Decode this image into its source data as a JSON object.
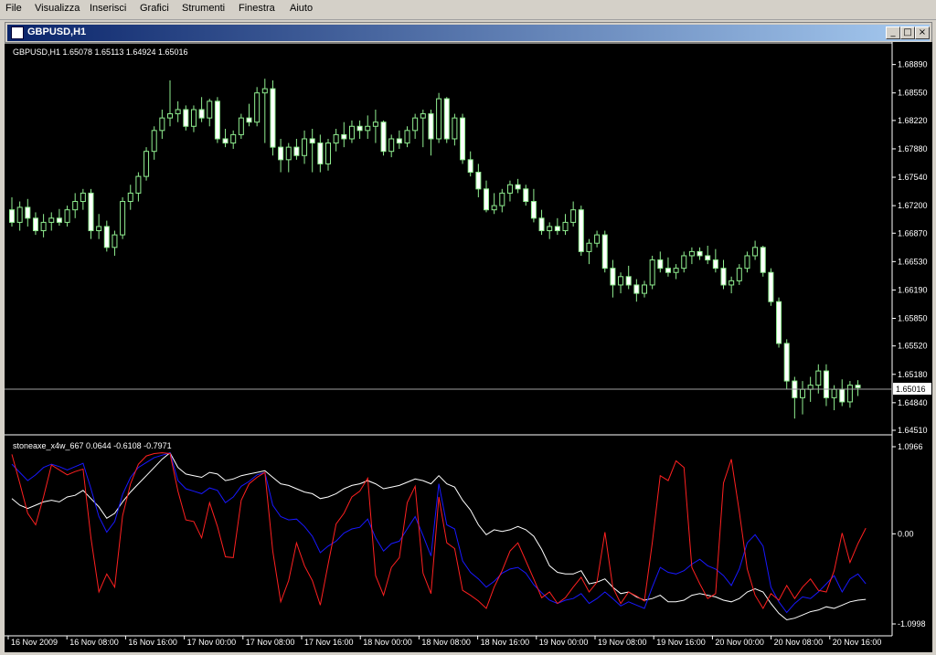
{
  "menu": [
    "File",
    "Visualizza",
    "Inserisci",
    "Grafici",
    "Strumenti",
    "Finestra",
    "Aiuto"
  ],
  "window": {
    "title": "GBPUSD,H1"
  },
  "price_panel": {
    "info": "GBPUSD,H1  1.65078 1.65113 1.64924 1.65016",
    "price_labels": [
      "1.68890",
      "1.68550",
      "1.68220",
      "1.67880",
      "1.67540",
      "1.67200",
      "1.66870",
      "1.66530",
      "1.66190",
      "1.65850",
      "1.65520",
      "1.65180",
      "1.64840",
      "1.64510"
    ],
    "current_price": "1.65016",
    "colors": {
      "candle": "#90ee90",
      "bull_body": "#000000",
      "bear_body": "#ffffff",
      "grid": "#ffffff"
    }
  },
  "indicator_panel": {
    "info": "stoneaxe_x4w_667 0.0644 -0.6108 -0.7971",
    "scale_labels": [
      "1.0966",
      "0.00",
      "-1.0998"
    ]
  },
  "time_labels": [
    "16 Nov 2009",
    "16 Nov 08:00",
    "16 Nov 16:00",
    "17 Nov 00:00",
    "17 Nov 08:00",
    "17 Nov 16:00",
    "18 Nov 00:00",
    "18 Nov 08:00",
    "18 Nov 16:00",
    "19 Nov 00:00",
    "19 Nov 08:00",
    "19 Nov 16:00",
    "20 Nov 00:00",
    "20 Nov 08:00",
    "20 Nov 16:00"
  ],
  "chart_data": {
    "type": "candlestick",
    "symbol": "GBPUSD",
    "timeframe": "H1",
    "ylim": [
      1.6451,
      1.6905
    ],
    "ohlc": [
      [
        1.6715,
        1.673,
        1.6695,
        1.67
      ],
      [
        1.67,
        1.6725,
        1.669,
        1.6718
      ],
      [
        1.6718,
        1.6728,
        1.6695,
        1.6705
      ],
      [
        1.6705,
        1.6712,
        1.6685,
        1.669
      ],
      [
        1.669,
        1.671,
        1.6682,
        1.67
      ],
      [
        1.67,
        1.6712,
        1.669,
        1.6705
      ],
      [
        1.6705,
        1.6716,
        1.6696,
        1.67
      ],
      [
        1.67,
        1.672,
        1.6695,
        1.6715
      ],
      [
        1.6715,
        1.6735,
        1.6705,
        1.6725
      ],
      [
        1.6725,
        1.674,
        1.6715,
        1.6735
      ],
      [
        1.6735,
        1.674,
        1.668,
        1.669
      ],
      [
        1.669,
        1.671,
        1.668,
        1.6695
      ],
      [
        1.6695,
        1.6702,
        1.6665,
        1.667
      ],
      [
        1.667,
        1.669,
        1.666,
        1.6685
      ],
      [
        1.6685,
        1.673,
        1.668,
        1.6725
      ],
      [
        1.6725,
        1.6745,
        1.6715,
        1.6735
      ],
      [
        1.6735,
        1.676,
        1.6725,
        1.6755
      ],
      [
        1.6755,
        1.679,
        1.675,
        1.6785
      ],
      [
        1.6785,
        1.6815,
        1.6775,
        1.681
      ],
      [
        1.681,
        1.6835,
        1.68,
        1.6825
      ],
      [
        1.6825,
        1.687,
        1.6815,
        1.683
      ],
      [
        1.683,
        1.6845,
        1.682,
        1.6835
      ],
      [
        1.6835,
        1.684,
        1.681,
        1.6815
      ],
      [
        1.6815,
        1.684,
        1.6808,
        1.6835
      ],
      [
        1.6835,
        1.685,
        1.682,
        1.6825
      ],
      [
        1.6825,
        1.6848,
        1.6815,
        1.6845
      ],
      [
        1.6845,
        1.685,
        1.6795,
        1.68
      ],
      [
        1.68,
        1.6812,
        1.679,
        1.6795
      ],
      [
        1.6795,
        1.681,
        1.6788,
        1.6805
      ],
      [
        1.6805,
        1.683,
        1.68,
        1.6825
      ],
      [
        1.6825,
        1.6842,
        1.6815,
        1.682
      ],
      [
        1.682,
        1.6862,
        1.6815,
        1.6855
      ],
      [
        1.6855,
        1.6872,
        1.6795,
        1.686
      ],
      [
        1.686,
        1.687,
        1.678,
        1.679
      ],
      [
        1.679,
        1.68,
        1.676,
        1.6775
      ],
      [
        1.6775,
        1.6795,
        1.676,
        1.679
      ],
      [
        1.679,
        1.68,
        1.6775,
        1.678
      ],
      [
        1.678,
        1.681,
        1.677,
        1.68
      ],
      [
        1.68,
        1.6812,
        1.676,
        1.6795
      ],
      [
        1.6795,
        1.6805,
        1.676,
        1.677
      ],
      [
        1.677,
        1.68,
        1.6762,
        1.6795
      ],
      [
        1.6795,
        1.6812,
        1.6785,
        1.6805
      ],
      [
        1.6805,
        1.682,
        1.679,
        1.68
      ],
      [
        1.68,
        1.6822,
        1.6795,
        1.6815
      ],
      [
        1.6815,
        1.6822,
        1.68,
        1.681
      ],
      [
        1.681,
        1.6828,
        1.68,
        1.6815
      ],
      [
        1.6815,
        1.6835,
        1.6795,
        1.682
      ],
      [
        1.682,
        1.6822,
        1.678,
        1.6785
      ],
      [
        1.6785,
        1.6805,
        1.6778,
        1.68
      ],
      [
        1.68,
        1.681,
        1.6788,
        1.6795
      ],
      [
        1.6795,
        1.6815,
        1.679,
        1.681
      ],
      [
        1.681,
        1.683,
        1.68,
        1.6825
      ],
      [
        1.6825,
        1.6835,
        1.679,
        1.683
      ],
      [
        1.683,
        1.6835,
        1.678,
        1.68
      ],
      [
        1.68,
        1.6855,
        1.6795,
        1.6848
      ],
      [
        1.6848,
        1.685,
        1.6795,
        1.68
      ],
      [
        1.68,
        1.683,
        1.6792,
        1.6825
      ],
      [
        1.6825,
        1.683,
        1.677,
        1.6775
      ],
      [
        1.6775,
        1.6785,
        1.6755,
        1.676
      ],
      [
        1.676,
        1.677,
        1.673,
        1.674
      ],
      [
        1.674,
        1.675,
        1.6712,
        1.6715
      ],
      [
        1.6715,
        1.6735,
        1.671,
        1.672
      ],
      [
        1.672,
        1.674,
        1.6712,
        1.6735
      ],
      [
        1.6735,
        1.675,
        1.6725,
        1.6745
      ],
      [
        1.6745,
        1.6752,
        1.6735,
        1.674
      ],
      [
        1.674,
        1.6745,
        1.672,
        1.6725
      ],
      [
        1.6725,
        1.674,
        1.67,
        1.6705
      ],
      [
        1.6705,
        1.6715,
        1.6685,
        1.669
      ],
      [
        1.669,
        1.67,
        1.668,
        1.6695
      ],
      [
        1.6695,
        1.6705,
        1.6685,
        1.669
      ],
      [
        1.669,
        1.671,
        1.6685,
        1.67
      ],
      [
        1.67,
        1.6725,
        1.6695,
        1.6715
      ],
      [
        1.6715,
        1.672,
        1.666,
        1.6665
      ],
      [
        1.6665,
        1.668,
        1.665,
        1.6675
      ],
      [
        1.6675,
        1.669,
        1.667,
        1.6685
      ],
      [
        1.6685,
        1.669,
        1.664,
        1.6645
      ],
      [
        1.6645,
        1.6655,
        1.661,
        1.6625
      ],
      [
        1.6625,
        1.664,
        1.6615,
        1.6635
      ],
      [
        1.6635,
        1.6648,
        1.662,
        1.6625
      ],
      [
        1.6625,
        1.6632,
        1.6605,
        1.6615
      ],
      [
        1.6615,
        1.663,
        1.661,
        1.6625
      ],
      [
        1.6625,
        1.666,
        1.662,
        1.6655
      ],
      [
        1.6655,
        1.6665,
        1.664,
        1.6645
      ],
      [
        1.6645,
        1.6658,
        1.6635,
        1.664
      ],
      [
        1.664,
        1.665,
        1.6632,
        1.6645
      ],
      [
        1.6645,
        1.6665,
        1.664,
        1.666
      ],
      [
        1.666,
        1.667,
        1.665,
        1.6665
      ],
      [
        1.6665,
        1.667,
        1.6655,
        1.666
      ],
      [
        1.666,
        1.6672,
        1.665,
        1.6655
      ],
      [
        1.6655,
        1.6668,
        1.664,
        1.6645
      ],
      [
        1.6645,
        1.6655,
        1.662,
        1.6625
      ],
      [
        1.6625,
        1.6635,
        1.6615,
        1.663
      ],
      [
        1.663,
        1.665,
        1.6625,
        1.6645
      ],
      [
        1.6645,
        1.6665,
        1.664,
        1.666
      ],
      [
        1.666,
        1.6678,
        1.6655,
        1.667
      ],
      [
        1.667,
        1.6672,
        1.6635,
        1.664
      ],
      [
        1.664,
        1.6645,
        1.66,
        1.6605
      ],
      [
        1.6605,
        1.661,
        1.655,
        1.6555
      ],
      [
        1.6555,
        1.656,
        1.65,
        1.651
      ],
      [
        1.651,
        1.6515,
        1.6465,
        1.649
      ],
      [
        1.649,
        1.651,
        1.647,
        1.65
      ],
      [
        1.65,
        1.6515,
        1.6485,
        1.6505
      ],
      [
        1.6505,
        1.653,
        1.6495,
        1.6522
      ],
      [
        1.6522,
        1.653,
        1.648,
        1.649
      ],
      [
        1.649,
        1.6505,
        1.6475,
        1.65
      ],
      [
        1.65,
        1.6512,
        1.648,
        1.6485
      ],
      [
        1.6485,
        1.651,
        1.6478,
        1.6505
      ],
      [
        1.6505,
        1.6511,
        1.6492,
        1.6502
      ]
    ],
    "indicator": {
      "name": "stoneaxe_x4w_667",
      "ylim": [
        -1.0998,
        1.0966
      ],
      "series": [
        {
          "color": "#ffffff",
          "values": [
            0.43,
            0.35,
            0.31,
            0.35,
            0.39,
            0.41,
            0.39,
            0.45,
            0.47,
            0.53,
            0.43,
            0.33,
            0.19,
            0.25,
            0.39,
            0.51,
            0.61,
            0.71,
            0.81,
            0.91,
            0.99,
            0.81,
            0.73,
            0.71,
            0.69,
            0.75,
            0.73,
            0.65,
            0.67,
            0.71,
            0.73,
            0.75,
            0.77,
            0.69,
            0.61,
            0.59,
            0.55,
            0.51,
            0.49,
            0.43,
            0.45,
            0.49,
            0.55,
            0.59,
            0.61,
            0.65,
            0.61,
            0.55,
            0.57,
            0.59,
            0.63,
            0.67,
            0.65,
            0.61,
            0.71,
            0.61,
            0.57,
            0.41,
            0.29,
            0.11,
            -0.01,
            0.05,
            0.03,
            0.05,
            0.09,
            0.05,
            -0.03,
            -0.19,
            -0.39,
            -0.47,
            -0.49,
            -0.49,
            -0.45,
            -0.61,
            -0.59,
            -0.55,
            -0.65,
            -0.73,
            -0.71,
            -0.77,
            -0.81,
            -0.79,
            -0.75,
            -0.83,
            -0.83,
            -0.81,
            -0.75,
            -0.73,
            -0.75,
            -0.77,
            -0.81,
            -0.83,
            -0.79,
            -0.71,
            -0.67,
            -0.71,
            -0.85,
            -0.97,
            -1.05,
            -1.03,
            -0.99,
            -0.95,
            -0.93,
            -0.89,
            -0.91,
            -0.87,
            -0.83,
            -0.81,
            -0.8
          ]
        },
        {
          "color": "#1818ff",
          "values": [
            0.85,
            0.75,
            0.65,
            0.72,
            0.81,
            0.85,
            0.82,
            0.78,
            0.82,
            0.86,
            0.55,
            0.21,
            0.02,
            0.15,
            0.48,
            0.69,
            0.81,
            0.87,
            0.93,
            0.96,
            0.99,
            0.65,
            0.55,
            0.52,
            0.49,
            0.56,
            0.53,
            0.38,
            0.45,
            0.58,
            0.64,
            0.72,
            0.75,
            0.35,
            0.21,
            0.17,
            0.18,
            0.09,
            -0.03,
            -0.23,
            -0.15,
            -0.09,
            0.01,
            0.06,
            0.08,
            0.18,
            -0.05,
            -0.21,
            -0.12,
            -0.09,
            0.06,
            0.21,
            -0.02,
            -0.27,
            0.61,
            0.11,
            0.06,
            -0.33,
            -0.47,
            -0.55,
            -0.65,
            -0.58,
            -0.48,
            -0.43,
            -0.41,
            -0.48,
            -0.62,
            -0.72,
            -0.81,
            -0.85,
            -0.81,
            -0.79,
            -0.73,
            -0.85,
            -0.79,
            -0.71,
            -0.79,
            -0.88,
            -0.83,
            -0.87,
            -0.91,
            -0.65,
            -0.41,
            -0.47,
            -0.49,
            -0.45,
            -0.37,
            -0.31,
            -0.39,
            -0.43,
            -0.51,
            -0.63,
            -0.43,
            -0.11,
            -0.01,
            -0.15,
            -0.65,
            -0.83,
            -0.96,
            -0.85,
            -0.77,
            -0.79,
            -0.71,
            -0.61,
            -0.51,
            -0.71,
            -0.55,
            -0.49,
            -0.61
          ]
        },
        {
          "color": "#ff2020",
          "values": [
            0.97,
            0.62,
            0.25,
            0.11,
            0.45,
            0.84,
            0.78,
            0.72,
            0.76,
            0.79,
            -0.05,
            -0.71,
            -0.49,
            -0.65,
            0.22,
            0.61,
            0.85,
            0.95,
            0.98,
            0.99,
            0.98,
            0.52,
            0.17,
            0.15,
            -0.05,
            0.38,
            0.09,
            -0.28,
            -0.29,
            0.41,
            0.61,
            0.69,
            0.75,
            -0.21,
            -0.83,
            -0.57,
            -0.11,
            -0.39,
            -0.57,
            -0.87,
            -0.37,
            0.12,
            0.25,
            0.45,
            0.52,
            0.68,
            -0.51,
            -0.75,
            -0.41,
            -0.29,
            0.38,
            0.58,
            -0.48,
            -0.73,
            0.45,
            -0.11,
            -0.18,
            -0.69,
            -0.75,
            -0.82,
            -0.91,
            -0.65,
            -0.45,
            -0.21,
            -0.11,
            -0.33,
            -0.55,
            -0.78,
            -0.71,
            -0.85,
            -0.78,
            -0.65,
            -0.53,
            -0.71,
            -0.59,
            0.02,
            -0.65,
            -0.85,
            -0.71,
            -0.76,
            -0.82,
            -0.11,
            0.71,
            0.65,
            0.89,
            0.81,
            -0.41,
            -0.61,
            -0.79,
            -0.73,
            0.62,
            0.91,
            0.27,
            -0.43,
            -0.75,
            -0.91,
            -0.73,
            -0.81,
            -0.63,
            -0.79,
            -0.65,
            -0.55,
            -0.69,
            -0.71,
            -0.45,
            0.01,
            -0.35,
            -0.12,
            0.07
          ]
        }
      ]
    }
  }
}
